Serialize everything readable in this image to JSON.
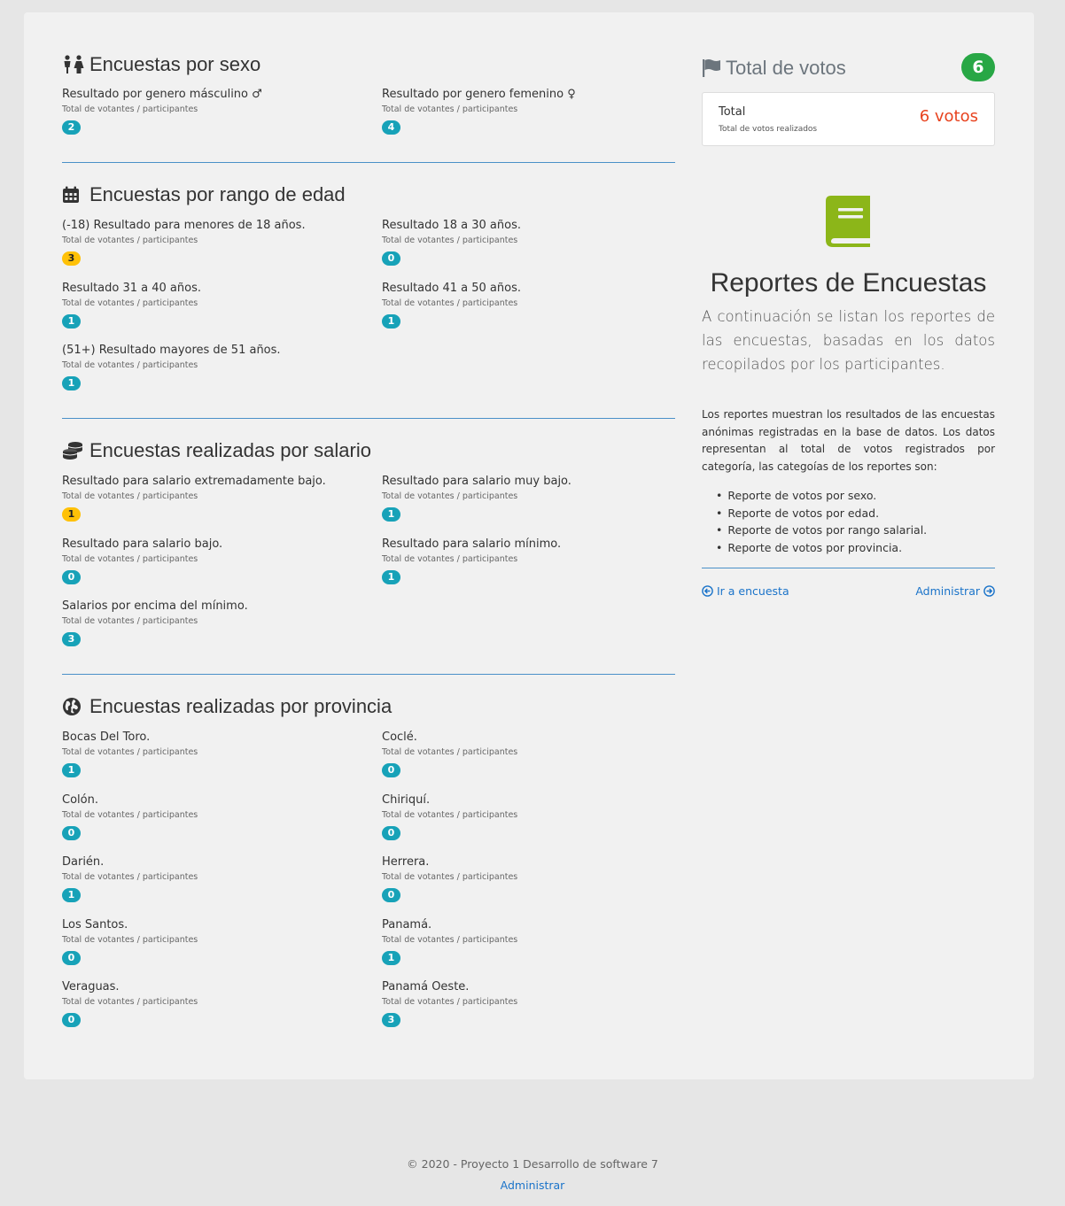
{
  "sexo": {
    "title": "Encuestas por sexo",
    "items": [
      {
        "label": "Resultado por genero másculino",
        "sub": "Total de votantes / participantes",
        "value": "2"
      },
      {
        "label": "Resultado por genero femenino",
        "sub": "Total de votantes / participantes",
        "value": "4"
      }
    ]
  },
  "edad": {
    "title": "Encuestas por rango de edad",
    "items": [
      {
        "label": "(-18) Resultado para menores de 18 años.",
        "sub": "Total de votantes / participantes",
        "value": "3"
      },
      {
        "label": "Resultado 18 a 30 años.",
        "sub": "Total de votantes / participantes",
        "value": "0"
      },
      {
        "label": "Resultado 31 a 40 años.",
        "sub": "Total de votantes / participantes",
        "value": "1"
      },
      {
        "label": "Resultado 41 a 50 años.",
        "sub": "Total de votantes / participantes",
        "value": "1"
      },
      {
        "label": "(51+) Resultado mayores de 51 años.",
        "sub": "Total de votantes / participantes",
        "value": "1"
      }
    ]
  },
  "salario": {
    "title": "Encuestas realizadas por salario",
    "items": [
      {
        "label": "Resultado para salario extremadamente bajo.",
        "sub": "Total de votantes / participantes",
        "value": "1"
      },
      {
        "label": "Resultado para salario muy bajo.",
        "sub": "Total de votantes / participantes",
        "value": "1"
      },
      {
        "label": "Resultado para salario bajo.",
        "sub": "Total de votantes / participantes",
        "value": "0"
      },
      {
        "label": "Resultado para salario mínimo.",
        "sub": "Total de votantes / participantes",
        "value": "1"
      },
      {
        "label": "Salarios por encima del mínimo.",
        "sub": "Total de votantes / participantes",
        "value": "3"
      }
    ]
  },
  "provincia": {
    "title": "Encuestas realizadas por provincia",
    "items": [
      {
        "label": "Bocas Del Toro.",
        "sub": "Total de votantes / participantes",
        "value": "1"
      },
      {
        "label": "Coclé.",
        "sub": "Total de votantes / participantes",
        "value": "0"
      },
      {
        "label": "Colón.",
        "sub": "Total de votantes / participantes",
        "value": "0"
      },
      {
        "label": "Chiriquí.",
        "sub": "Total de votantes / participantes",
        "value": "0"
      },
      {
        "label": "Darién.",
        "sub": "Total de votantes / participantes",
        "value": "1"
      },
      {
        "label": "Herrera.",
        "sub": "Total de votantes / participantes",
        "value": "0"
      },
      {
        "label": "Los Santos.",
        "sub": "Total de votantes / participantes",
        "value": "0"
      },
      {
        "label": "Panamá.",
        "sub": "Total de votantes / participantes",
        "value": "1"
      },
      {
        "label": "Veraguas.",
        "sub": "Total de votantes / participantes",
        "value": "0"
      },
      {
        "label": "Panamá Oeste.",
        "sub": "Total de votantes / participantes",
        "value": "3"
      }
    ]
  },
  "total": {
    "title": "Total de votos",
    "count": "6",
    "box_label": "Total",
    "box_sub": "Total de votos realizados",
    "box_value": "6 votos"
  },
  "reportes": {
    "title": "Reportes de Encuestas",
    "lead": "A continuación se listan los reportes de las encuestas, basadas en los datos recopilados por los participantes.",
    "body": "Los reportes muestran los resultados de las encuestas anónimas registradas en la base de datos. Los datos representan al total de votos registrados por categoría, las categoías de los reportes son:",
    "list": [
      "Reporte de votos por sexo.",
      "Reporte de votos por edad.",
      "Reporte de votos por rango salarial.",
      "Reporte de votos por provincia."
    ],
    "link_back": "Ir a encuesta",
    "link_admin": "Administrar"
  },
  "footer": {
    "copyright": "© 2020 - Proyecto 1 Desarrollo de software 7",
    "admin_link": "Administrar"
  },
  "colors": {
    "badge_info": "#17a2b8",
    "badge_warning": "#ffc107",
    "badge_success": "#28a745",
    "accent_link": "#1a73c9",
    "votes_red": "#e8431f"
  }
}
